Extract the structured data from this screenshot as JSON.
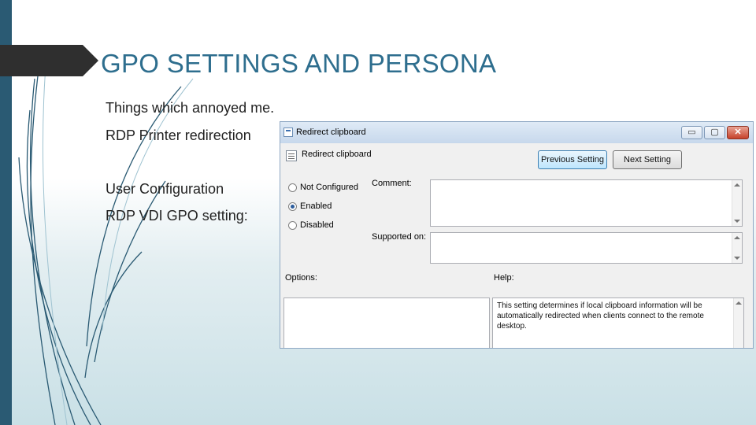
{
  "slide": {
    "title": "GPO SETTINGS AND PERSONA",
    "bullets": [
      "Things which annoyed me.",
      "RDP Printer redirection",
      "User Configuration",
      "RDP VDI GPO setting:"
    ]
  },
  "dialog": {
    "window_title": "Redirect clipboard",
    "window_controls": {
      "minimize": "▭",
      "maximize": "▢",
      "close": "✕"
    },
    "policy_name": "Redirect clipboard",
    "previous_label": "Previous Setting",
    "next_label": "Next Setting",
    "radio_options": [
      {
        "label": "Not Configured",
        "selected": false
      },
      {
        "label": "Enabled",
        "selected": true
      },
      {
        "label": "Disabled",
        "selected": false
      }
    ],
    "comment_label": "Comment:",
    "comment_value": "",
    "supported_label": "Supported on:",
    "supported_value": "",
    "options_label": "Options:",
    "help_label": "Help:",
    "help_text": "This setting determines if local clipboard information will be automatically redirected when clients connect to the remote desktop."
  },
  "colors": {
    "accent": "#2e6e8e",
    "left_bar": "#2a5a73",
    "title_arrow": "#2f2f2f"
  }
}
